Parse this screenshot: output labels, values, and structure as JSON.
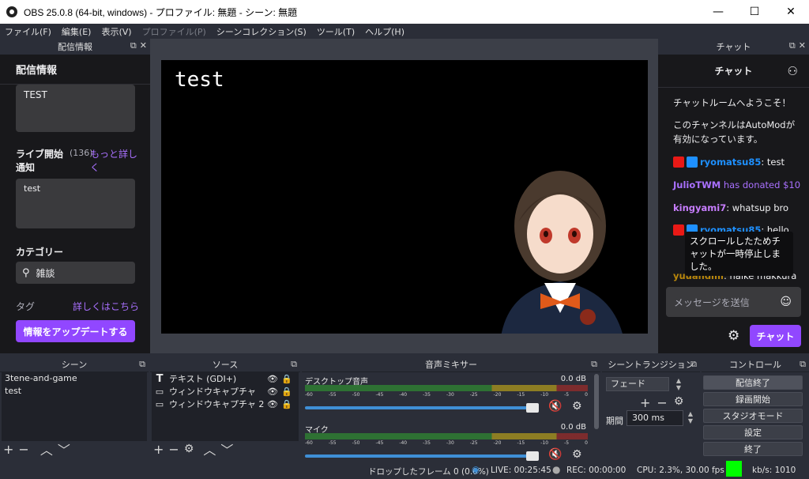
{
  "window": {
    "title": "OBS 25.0.8 (64-bit, windows) - プロファイル: 無題 - シーン: 無題",
    "minimize": "—",
    "maximize": "☐",
    "close": "✕"
  },
  "menu": [
    "ファイル(F)",
    "編集(E)",
    "表示(V)",
    "プロファイル(P)",
    "シーンコレクション(S)",
    "ツール(T)",
    "ヘルプ(H)"
  ],
  "menu_disabled_index": 3,
  "stream_info": {
    "dock_title": "配信情報",
    "heading": "配信情報",
    "title_value": "TEST",
    "notify_label": "ライブ開始通知",
    "notify_count": "(136)",
    "more_link": "もっと詳しく",
    "notify_value": "test",
    "category_label": "カテゴリー",
    "category_value": "雑談",
    "tags_label": "タグ",
    "tags_link": "詳しくはこちら",
    "update_button": "情報をアップデートする"
  },
  "preview": {
    "text": "test"
  },
  "chat": {
    "dock_title": "チャット",
    "header": "チャット",
    "welcome": "チャットルームへようこそ！",
    "automod": "このチャンネルはAutoModが有効になっています。",
    "messages": [
      {
        "user": "ryomatsu85",
        "text": ": test",
        "color": "#1e90ff"
      },
      {
        "user": "JulioTWM",
        "text": " has donated $10",
        "color": "#a970ff"
      },
      {
        "user": "kingyami7",
        "text": ": whatsup bro",
        "color": "#c77dff"
      },
      {
        "user": "ryomatsu85",
        "text": ": hello",
        "color": "#1e90ff"
      },
      {
        "user": "yuuandmi",
        "text": ": haike makkura",
        "color": "#b8860b"
      }
    ],
    "tooltip": "スクロールしたためチャットが一時停止しました。",
    "input_placeholder": "メッセージを送信",
    "send_button": "チャット"
  },
  "scenes": {
    "title": "シーン",
    "items": [
      "3tene-and-game",
      "test"
    ]
  },
  "sources": {
    "title": "ソース",
    "items": [
      {
        "label": "テキスト (GDI+)",
        "icon": "text-icon"
      },
      {
        "label": "ウィンドウキャプチャ",
        "icon": "window-icon"
      },
      {
        "label": "ウィンドウキャプチャ 2",
        "icon": "window-icon"
      }
    ]
  },
  "mixer": {
    "title": "音声ミキサー",
    "channels": [
      {
        "name": "デスクトップ音声",
        "db": "0.0 dB"
      },
      {
        "name": "マイク",
        "db": "0.0 dB"
      }
    ],
    "ticks": [
      "-60",
      "-55",
      "-50",
      "-45",
      "-40",
      "-35",
      "-30",
      "-25",
      "-20",
      "-15",
      "-10",
      "-5",
      "0"
    ]
  },
  "transitions": {
    "title": "シーントランジション",
    "selected": "フェード",
    "duration_label": "期間",
    "duration_value": "300 ms"
  },
  "controls": {
    "title": "コントロール",
    "buttons": [
      "配信終了",
      "録画開始",
      "スタジオモード",
      "設定",
      "終了"
    ]
  },
  "status": {
    "dropped": "ドロップしたフレーム 0 (0.0%)",
    "live": "LIVE: 00:25:45",
    "rec": "REC: 00:00:00",
    "cpu": "CPU: 2.3%, 30.00 fps",
    "kbs": "kb/s: 1010"
  },
  "colors": {
    "accent": "#9147ff",
    "twitch_bg": "#18181b",
    "obs_bg": "#2b2e38",
    "status_ok": "#00ff00"
  }
}
